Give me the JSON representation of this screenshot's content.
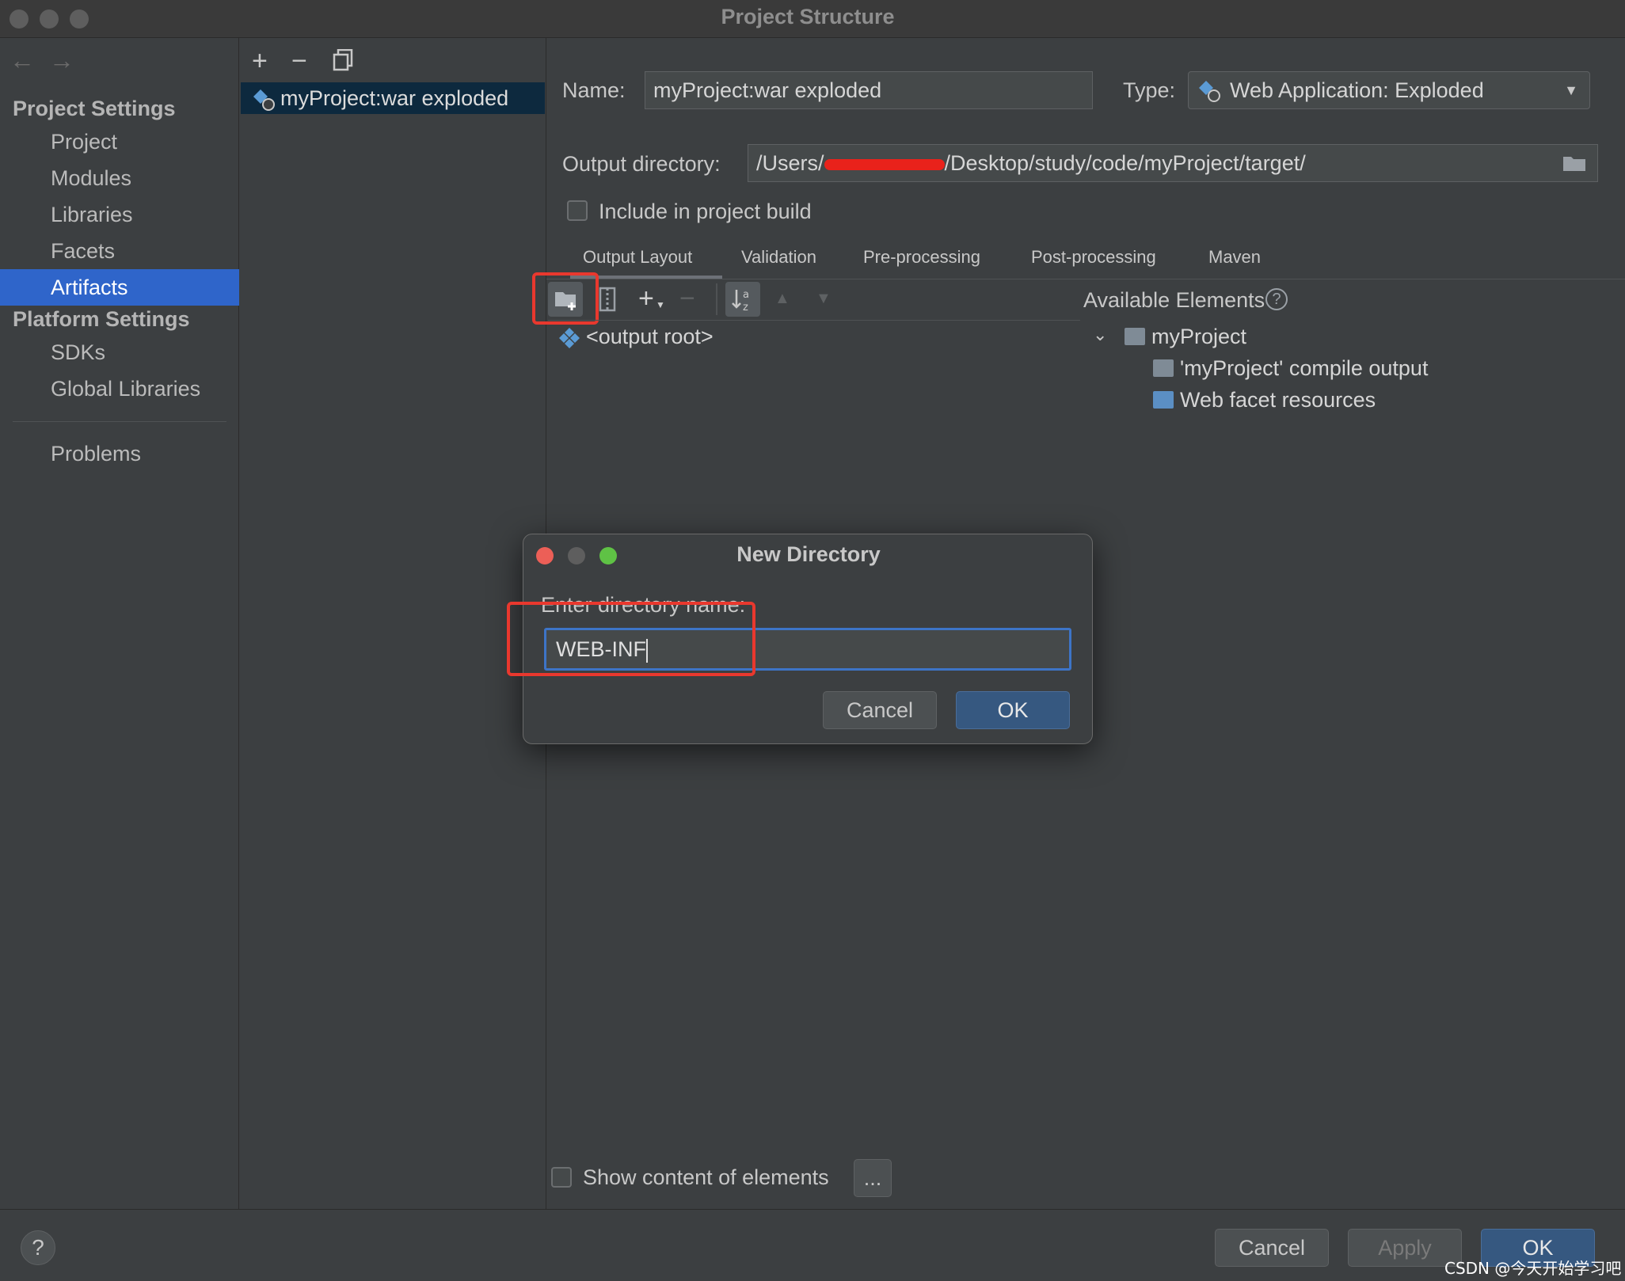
{
  "window": {
    "title": "Project Structure"
  },
  "sidebar": {
    "project_settings_header": "Project Settings",
    "project_items": [
      "Project",
      "Modules",
      "Libraries",
      "Facets",
      "Artifacts"
    ],
    "platform_settings_header": "Platform Settings",
    "platform_items": [
      "SDKs",
      "Global Libraries"
    ],
    "problems": "Problems",
    "selected": "Artifacts"
  },
  "artifact_list": {
    "toolbar": [
      "add-icon",
      "remove-icon",
      "copy-icon"
    ],
    "items": [
      "myProject:war exploded"
    ]
  },
  "form": {
    "name_label": "Name:",
    "name_value": "myProject:war exploded",
    "type_label": "Type:",
    "type_value": "Web Application: Exploded",
    "output_dir_label": "Output directory:",
    "output_dir_prefix": "/Users/",
    "output_dir_suffix": "/Desktop/study/code/myProject/target/",
    "include_build_label": "Include in project build",
    "include_build_checked": false
  },
  "tabs": [
    "Output Layout",
    "Validation",
    "Pre-processing",
    "Post-processing",
    "Maven"
  ],
  "active_tab": "Output Layout",
  "layout_toolbar": [
    "new-folder-icon",
    "archive-icon",
    "add-icon",
    "remove-icon",
    "sort-icon",
    "move-up-icon",
    "move-down-icon"
  ],
  "output_tree": {
    "root": "<output root>"
  },
  "available": {
    "header": "Available Elements",
    "project": "myProject",
    "children": [
      "'myProject' compile output",
      "Web facet resources"
    ]
  },
  "show_content_label": "Show content of elements",
  "ellipsis_button": "...",
  "dialog": {
    "title": "New Directory",
    "prompt": "Enter directory name:",
    "input_value": "WEB-INF",
    "cancel": "Cancel",
    "ok": "OK"
  },
  "footer": {
    "help": "?",
    "cancel": "Cancel",
    "apply": "Apply",
    "ok": "OK",
    "watermark": "CSDN @今天开始学习吧"
  },
  "colors": {
    "selection": "#2f65ca",
    "highlight_red": "#e9382e",
    "primary_button": "#365880",
    "focus_border": "#3d74c7"
  }
}
